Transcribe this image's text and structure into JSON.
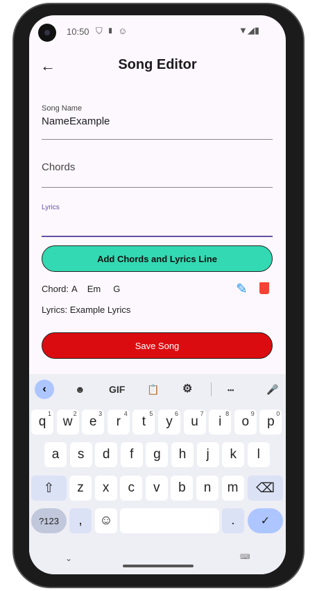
{
  "status_bar": {
    "time": "10:50"
  },
  "app_bar": {
    "title": "Song Editor"
  },
  "form": {
    "song_name": {
      "label": "Song Name",
      "value": "NameExample"
    },
    "chords": {
      "placeholder": "Chords"
    },
    "lyrics": {
      "label": "Lyrics",
      "value": ""
    }
  },
  "buttons": {
    "add_line": "Add Chords and Lyrics Line",
    "save": "Save Song"
  },
  "lines": [
    {
      "chord_prefix": "Chord:",
      "chords": [
        "A",
        "Em",
        "G"
      ],
      "lyrics": "Lyrics: Example Lyrics"
    }
  ],
  "colors": {
    "add_button": "#33d9b2",
    "save_button": "#db0c10",
    "edit_icon": "#2196f3",
    "delete_icon": "#f44336",
    "focus": "#6750a4"
  },
  "keyboard": {
    "toolbar": {
      "gif": "GIF",
      "more": "•••"
    },
    "row1": [
      [
        "q",
        "1"
      ],
      [
        "w",
        "2"
      ],
      [
        "e",
        "3"
      ],
      [
        "r",
        "4"
      ],
      [
        "t",
        "5"
      ],
      [
        "y",
        "6"
      ],
      [
        "u",
        "7"
      ],
      [
        "i",
        "8"
      ],
      [
        "o",
        "9"
      ],
      [
        "p",
        "0"
      ]
    ],
    "row2": [
      "a",
      "s",
      "d",
      "f",
      "g",
      "h",
      "j",
      "k",
      "l"
    ],
    "row3": [
      "z",
      "x",
      "c",
      "v",
      "b",
      "n",
      "m"
    ],
    "symbols": "?123",
    "comma": ",",
    "period": "."
  }
}
